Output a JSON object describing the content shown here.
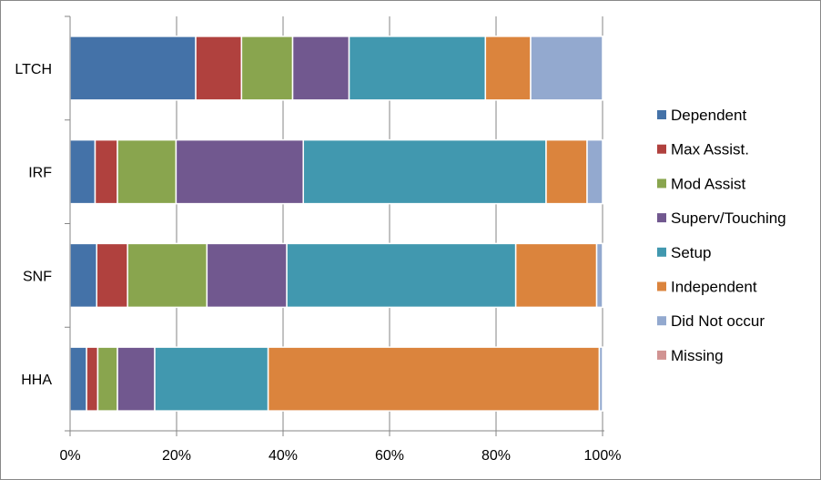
{
  "chart_data": {
    "type": "bar",
    "orientation": "horizontal",
    "stacked": "percent",
    "title": "",
    "xlabel": "",
    "ylabel": "",
    "xlim": [
      0,
      100
    ],
    "x_ticks": [
      "0%",
      "20%",
      "40%",
      "60%",
      "80%",
      "100%"
    ],
    "grid": true,
    "legend_position": "right",
    "categories": [
      "LTCH",
      "IRF",
      "SNF",
      "HHA"
    ],
    "series": [
      {
        "name": "Dependent",
        "color": "#4472a8",
        "values": [
          23.6,
          4.7,
          5.0,
          3.1
        ]
      },
      {
        "name": "Max Assist.",
        "color": "#b0413e",
        "values": [
          8.6,
          4.2,
          5.8,
          2.1
        ]
      },
      {
        "name": "Mod Assist",
        "color": "#89a54e",
        "values": [
          9.6,
          11.0,
          14.9,
          3.7
        ]
      },
      {
        "name": "Superv/Touching",
        "color": "#71588f",
        "values": [
          10.6,
          23.9,
          15.0,
          7.0
        ]
      },
      {
        "name": "Setup",
        "color": "#4198af",
        "values": [
          25.6,
          45.6,
          43.0,
          21.3
        ]
      },
      {
        "name": "Independent",
        "color": "#db843d",
        "values": [
          8.5,
          7.7,
          15.2,
          62.2
        ]
      },
      {
        "name": "Did Not occur",
        "color": "#93a9cf",
        "values": [
          13.5,
          2.9,
          1.1,
          0.6
        ]
      },
      {
        "name": "Missing",
        "color": "#d19392",
        "values": [
          0,
          0,
          0,
          0
        ]
      }
    ]
  }
}
